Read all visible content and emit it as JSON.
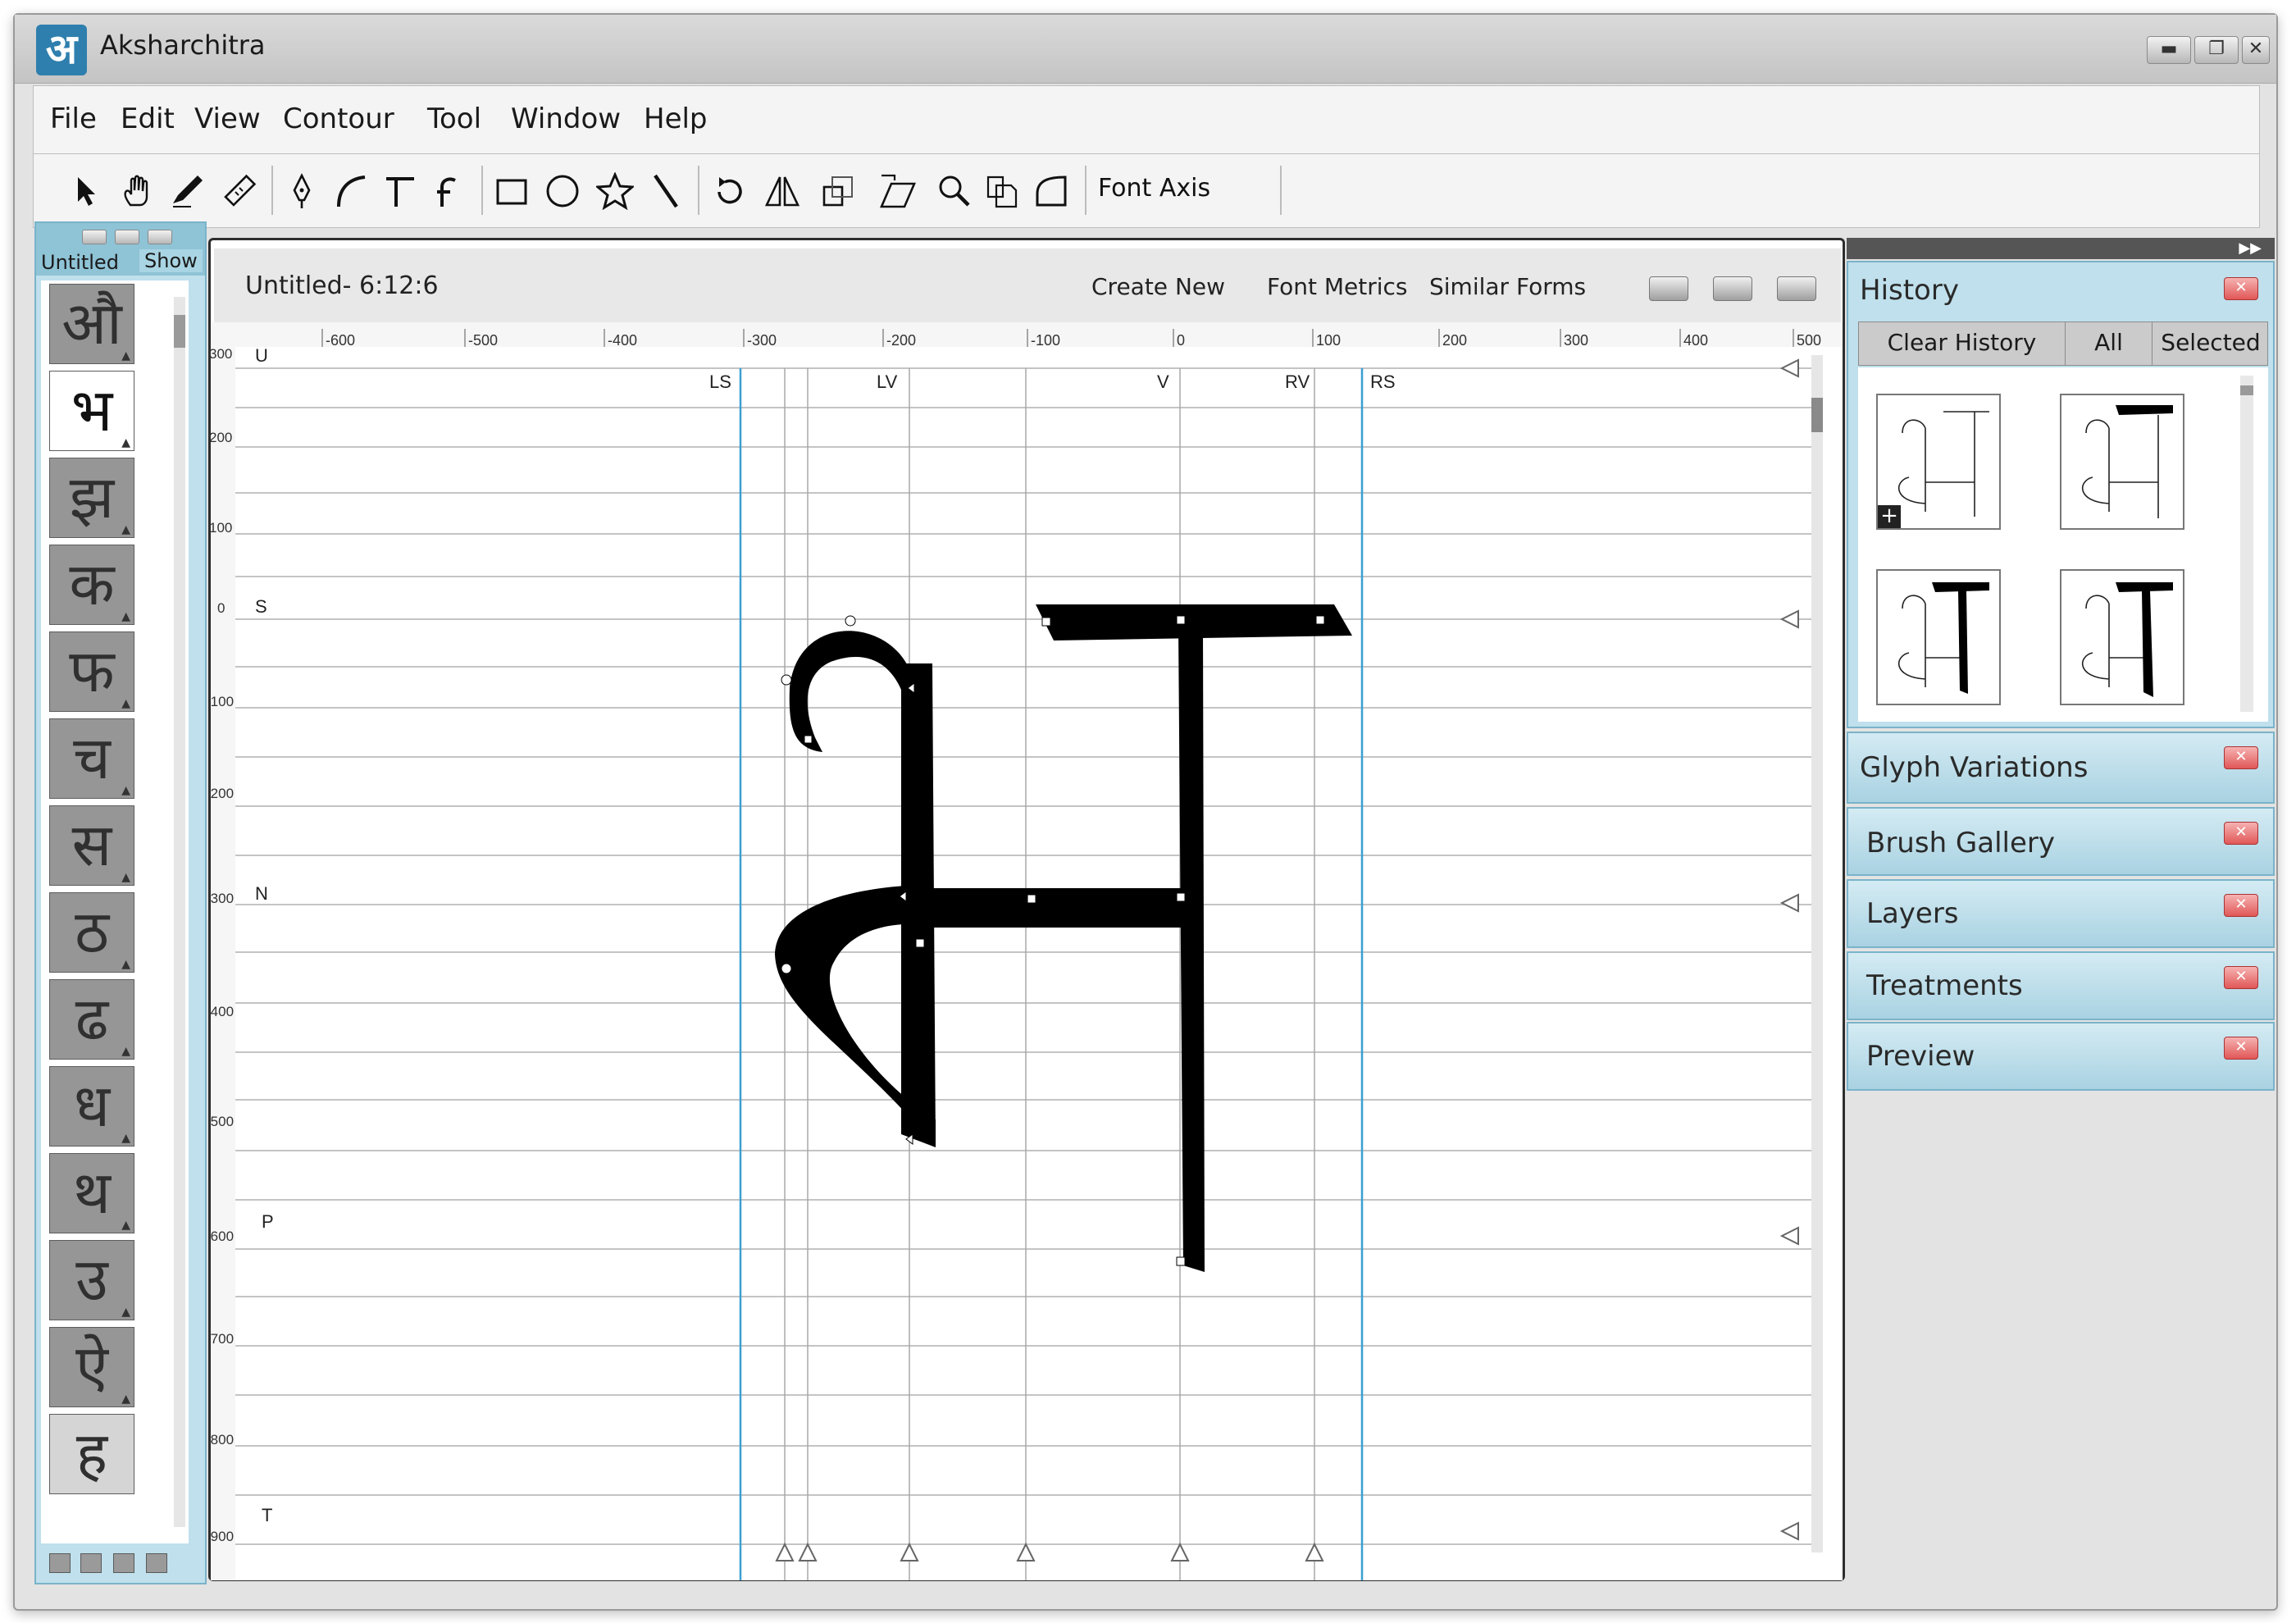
{
  "app": {
    "title": "Aksharchitra",
    "logo_glyph": "अ",
    "window_controls": [
      "minimize-icon",
      "restore-icon",
      "close-icon"
    ]
  },
  "menu": [
    "File",
    "Edit",
    "View",
    "Contour",
    "Tool",
    "Window",
    "Help"
  ],
  "toolbar": {
    "tools": [
      "pointer-icon",
      "hand-icon",
      "brush-icon",
      "ruler-icon",
      "pen-icon",
      "curve-icon",
      "corner-icon",
      "hook-icon",
      "rectangle-icon",
      "ellipse-icon",
      "star-icon",
      "line-icon",
      "rotate-icon",
      "reflect-icon",
      "scale-icon",
      "shear-icon",
      "zoom-icon",
      "copy-icon",
      "shape-icon"
    ],
    "font_axis_label": "Font Axis"
  },
  "glyph_palette": {
    "tab_label": "Untitled",
    "show_label": "Show",
    "glyphs": [
      "औ",
      "भ",
      "झ",
      "क",
      "फ",
      "च",
      "स",
      "ठ",
      "ढ",
      "ध",
      "थ",
      "उ",
      "ऐ",
      "ह"
    ]
  },
  "document": {
    "title": "Untitled- 6:12:6",
    "buttons": [
      "Create New",
      "Font Metrics",
      "Similar Forms"
    ],
    "ruler_x": [
      "-600",
      "-500",
      "-400",
      "-300",
      "-200",
      "-100",
      "0",
      "100",
      "200",
      "300",
      "400",
      "500"
    ],
    "ruler_y": [
      "300",
      "200",
      "100",
      "0",
      "-100",
      "-200",
      "-300",
      "-400",
      "-500",
      "-600",
      "-700",
      "-800",
      "-900"
    ],
    "vertical_guides": [
      "LS",
      "LV",
      "V",
      "RV",
      "RS"
    ],
    "horizontal_guides": [
      "U",
      "S",
      "N",
      "P",
      "T"
    ],
    "glyph": "भ"
  },
  "history": {
    "title": "History",
    "tabs": [
      "Clear History",
      "All",
      "Selected"
    ]
  },
  "panels": [
    "Glyph Variations",
    "Brush Gallery",
    "Layers",
    "Treatments",
    "Preview"
  ],
  "colors": {
    "accent_blue": "#2f7fae",
    "panel_blue": "#bfe0ec",
    "guide_blue": "#3a9fd3",
    "close_red": "#e15757"
  }
}
